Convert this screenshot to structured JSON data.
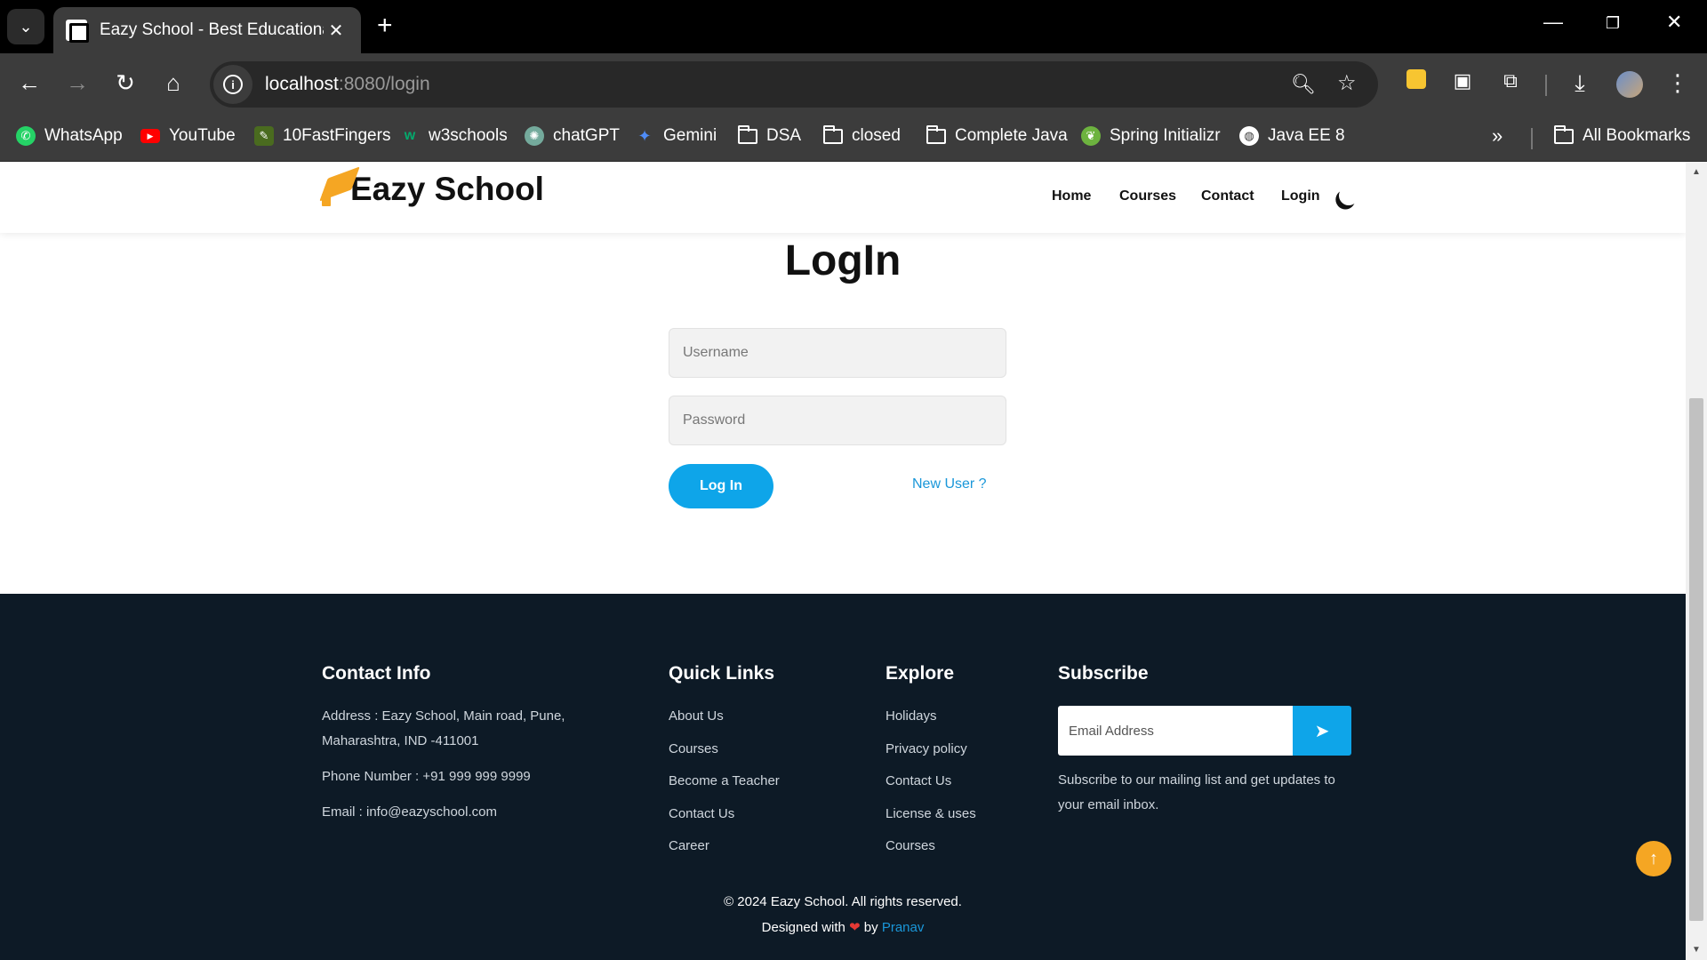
{
  "browser": {
    "tab_title": "Eazy School - Best Educational Institute",
    "url_host": "localhost",
    "url_rest": ":8080/login",
    "bookmarks": [
      {
        "label": "WhatsApp",
        "icon": "whatsapp-icon",
        "color": "#25D366"
      },
      {
        "label": "YouTube",
        "icon": "youtube-icon",
        "color": "#FF0000"
      },
      {
        "label": "10FastFingers",
        "icon": "10fastfingers-icon",
        "color": "#4a6b1f"
      },
      {
        "label": "w3schools",
        "icon": "w3schools-icon",
        "color": "#04AA6D"
      },
      {
        "label": "chatGPT",
        "icon": "chatgpt-icon",
        "color": "#74aa9c"
      },
      {
        "label": "Gemini",
        "icon": "gemini-icon",
        "color": "#4f8cf7"
      },
      {
        "label": "DSA",
        "icon": "folder-icon"
      },
      {
        "label": "closed",
        "icon": "folder-icon"
      },
      {
        "label": "Complete Java",
        "icon": "folder-icon"
      },
      {
        "label": "Spring Initializr",
        "icon": "spring-icon",
        "color": "#6db33f"
      },
      {
        "label": "Java EE 8",
        "icon": "globe-icon",
        "color": "#ffffff"
      }
    ],
    "all_bookmarks": "All Bookmarks"
  },
  "site": {
    "logo_text": "Eazy School",
    "nav": {
      "home": "Home",
      "courses": "Courses",
      "contact": "Contact",
      "login": "Login"
    }
  },
  "login": {
    "title": "LogIn",
    "username_placeholder": "Username",
    "password_placeholder": "Password",
    "button": "Log In",
    "new_user": "New User ?"
  },
  "footer": {
    "contact": {
      "heading": "Contact Info",
      "address_line1": "Address : Eazy School, Main road, Pune,",
      "address_line2": "Maharashtra, IND -411001",
      "phone": "Phone Number : +91 999 999 9999",
      "email": "Email : info@eazyschool.com"
    },
    "quick_links": {
      "heading": "Quick Links",
      "items": [
        "About Us",
        "Courses",
        "Become a Teacher",
        "Contact Us",
        "Career"
      ]
    },
    "explore": {
      "heading": "Explore",
      "items": [
        "Holidays",
        "Privacy policy",
        "Contact Us",
        "License & uses",
        "Courses"
      ]
    },
    "subscribe": {
      "heading": "Subscribe",
      "placeholder": "Email Address",
      "text_line1": "Subscribe to our mailing list and get updates to",
      "text_line2": "your email inbox."
    },
    "copyright": "© 2024 Eazy School. All rights reserved.",
    "designed_prefix": "Designed with",
    "designed_by": "by",
    "author": "Pranav"
  },
  "colors": {
    "accent": "#0ea5e9",
    "footer_bg": "#0d1a26",
    "logo": "#f5a623"
  }
}
